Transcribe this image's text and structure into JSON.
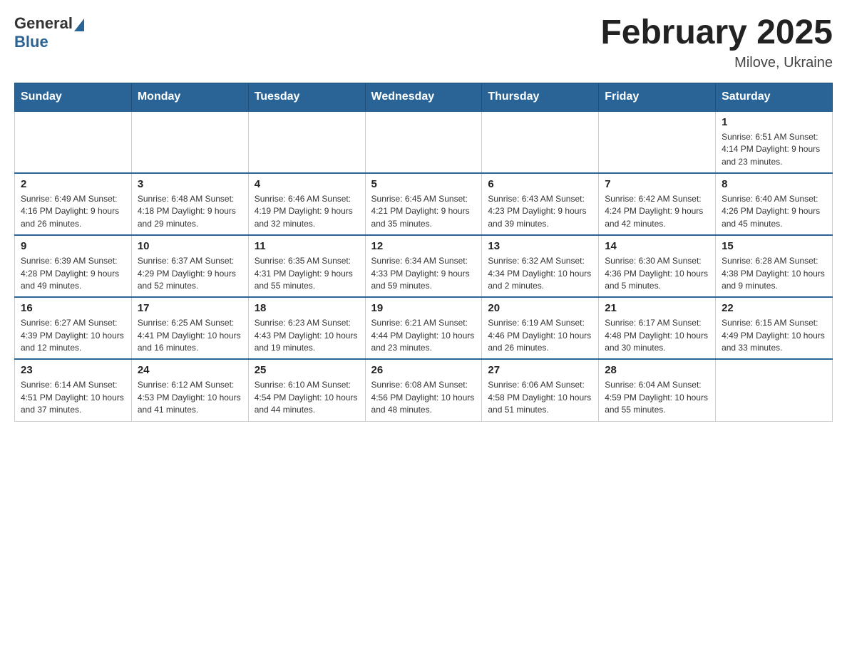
{
  "header": {
    "logo_text_general": "General",
    "logo_text_blue": "Blue",
    "title": "February 2025",
    "location": "Milove, Ukraine"
  },
  "weekdays": [
    "Sunday",
    "Monday",
    "Tuesday",
    "Wednesday",
    "Thursday",
    "Friday",
    "Saturday"
  ],
  "weeks": [
    [
      {
        "day": "",
        "info": ""
      },
      {
        "day": "",
        "info": ""
      },
      {
        "day": "",
        "info": ""
      },
      {
        "day": "",
        "info": ""
      },
      {
        "day": "",
        "info": ""
      },
      {
        "day": "",
        "info": ""
      },
      {
        "day": "1",
        "info": "Sunrise: 6:51 AM\nSunset: 4:14 PM\nDaylight: 9 hours and 23 minutes."
      }
    ],
    [
      {
        "day": "2",
        "info": "Sunrise: 6:49 AM\nSunset: 4:16 PM\nDaylight: 9 hours and 26 minutes."
      },
      {
        "day": "3",
        "info": "Sunrise: 6:48 AM\nSunset: 4:18 PM\nDaylight: 9 hours and 29 minutes."
      },
      {
        "day": "4",
        "info": "Sunrise: 6:46 AM\nSunset: 4:19 PM\nDaylight: 9 hours and 32 minutes."
      },
      {
        "day": "5",
        "info": "Sunrise: 6:45 AM\nSunset: 4:21 PM\nDaylight: 9 hours and 35 minutes."
      },
      {
        "day": "6",
        "info": "Sunrise: 6:43 AM\nSunset: 4:23 PM\nDaylight: 9 hours and 39 minutes."
      },
      {
        "day": "7",
        "info": "Sunrise: 6:42 AM\nSunset: 4:24 PM\nDaylight: 9 hours and 42 minutes."
      },
      {
        "day": "8",
        "info": "Sunrise: 6:40 AM\nSunset: 4:26 PM\nDaylight: 9 hours and 45 minutes."
      }
    ],
    [
      {
        "day": "9",
        "info": "Sunrise: 6:39 AM\nSunset: 4:28 PM\nDaylight: 9 hours and 49 minutes."
      },
      {
        "day": "10",
        "info": "Sunrise: 6:37 AM\nSunset: 4:29 PM\nDaylight: 9 hours and 52 minutes."
      },
      {
        "day": "11",
        "info": "Sunrise: 6:35 AM\nSunset: 4:31 PM\nDaylight: 9 hours and 55 minutes."
      },
      {
        "day": "12",
        "info": "Sunrise: 6:34 AM\nSunset: 4:33 PM\nDaylight: 9 hours and 59 minutes."
      },
      {
        "day": "13",
        "info": "Sunrise: 6:32 AM\nSunset: 4:34 PM\nDaylight: 10 hours and 2 minutes."
      },
      {
        "day": "14",
        "info": "Sunrise: 6:30 AM\nSunset: 4:36 PM\nDaylight: 10 hours and 5 minutes."
      },
      {
        "day": "15",
        "info": "Sunrise: 6:28 AM\nSunset: 4:38 PM\nDaylight: 10 hours and 9 minutes."
      }
    ],
    [
      {
        "day": "16",
        "info": "Sunrise: 6:27 AM\nSunset: 4:39 PM\nDaylight: 10 hours and 12 minutes."
      },
      {
        "day": "17",
        "info": "Sunrise: 6:25 AM\nSunset: 4:41 PM\nDaylight: 10 hours and 16 minutes."
      },
      {
        "day": "18",
        "info": "Sunrise: 6:23 AM\nSunset: 4:43 PM\nDaylight: 10 hours and 19 minutes."
      },
      {
        "day": "19",
        "info": "Sunrise: 6:21 AM\nSunset: 4:44 PM\nDaylight: 10 hours and 23 minutes."
      },
      {
        "day": "20",
        "info": "Sunrise: 6:19 AM\nSunset: 4:46 PM\nDaylight: 10 hours and 26 minutes."
      },
      {
        "day": "21",
        "info": "Sunrise: 6:17 AM\nSunset: 4:48 PM\nDaylight: 10 hours and 30 minutes."
      },
      {
        "day": "22",
        "info": "Sunrise: 6:15 AM\nSunset: 4:49 PM\nDaylight: 10 hours and 33 minutes."
      }
    ],
    [
      {
        "day": "23",
        "info": "Sunrise: 6:14 AM\nSunset: 4:51 PM\nDaylight: 10 hours and 37 minutes."
      },
      {
        "day": "24",
        "info": "Sunrise: 6:12 AM\nSunset: 4:53 PM\nDaylight: 10 hours and 41 minutes."
      },
      {
        "day": "25",
        "info": "Sunrise: 6:10 AM\nSunset: 4:54 PM\nDaylight: 10 hours and 44 minutes."
      },
      {
        "day": "26",
        "info": "Sunrise: 6:08 AM\nSunset: 4:56 PM\nDaylight: 10 hours and 48 minutes."
      },
      {
        "day": "27",
        "info": "Sunrise: 6:06 AM\nSunset: 4:58 PM\nDaylight: 10 hours and 51 minutes."
      },
      {
        "day": "28",
        "info": "Sunrise: 6:04 AM\nSunset: 4:59 PM\nDaylight: 10 hours and 55 minutes."
      },
      {
        "day": "",
        "info": ""
      }
    ]
  ]
}
